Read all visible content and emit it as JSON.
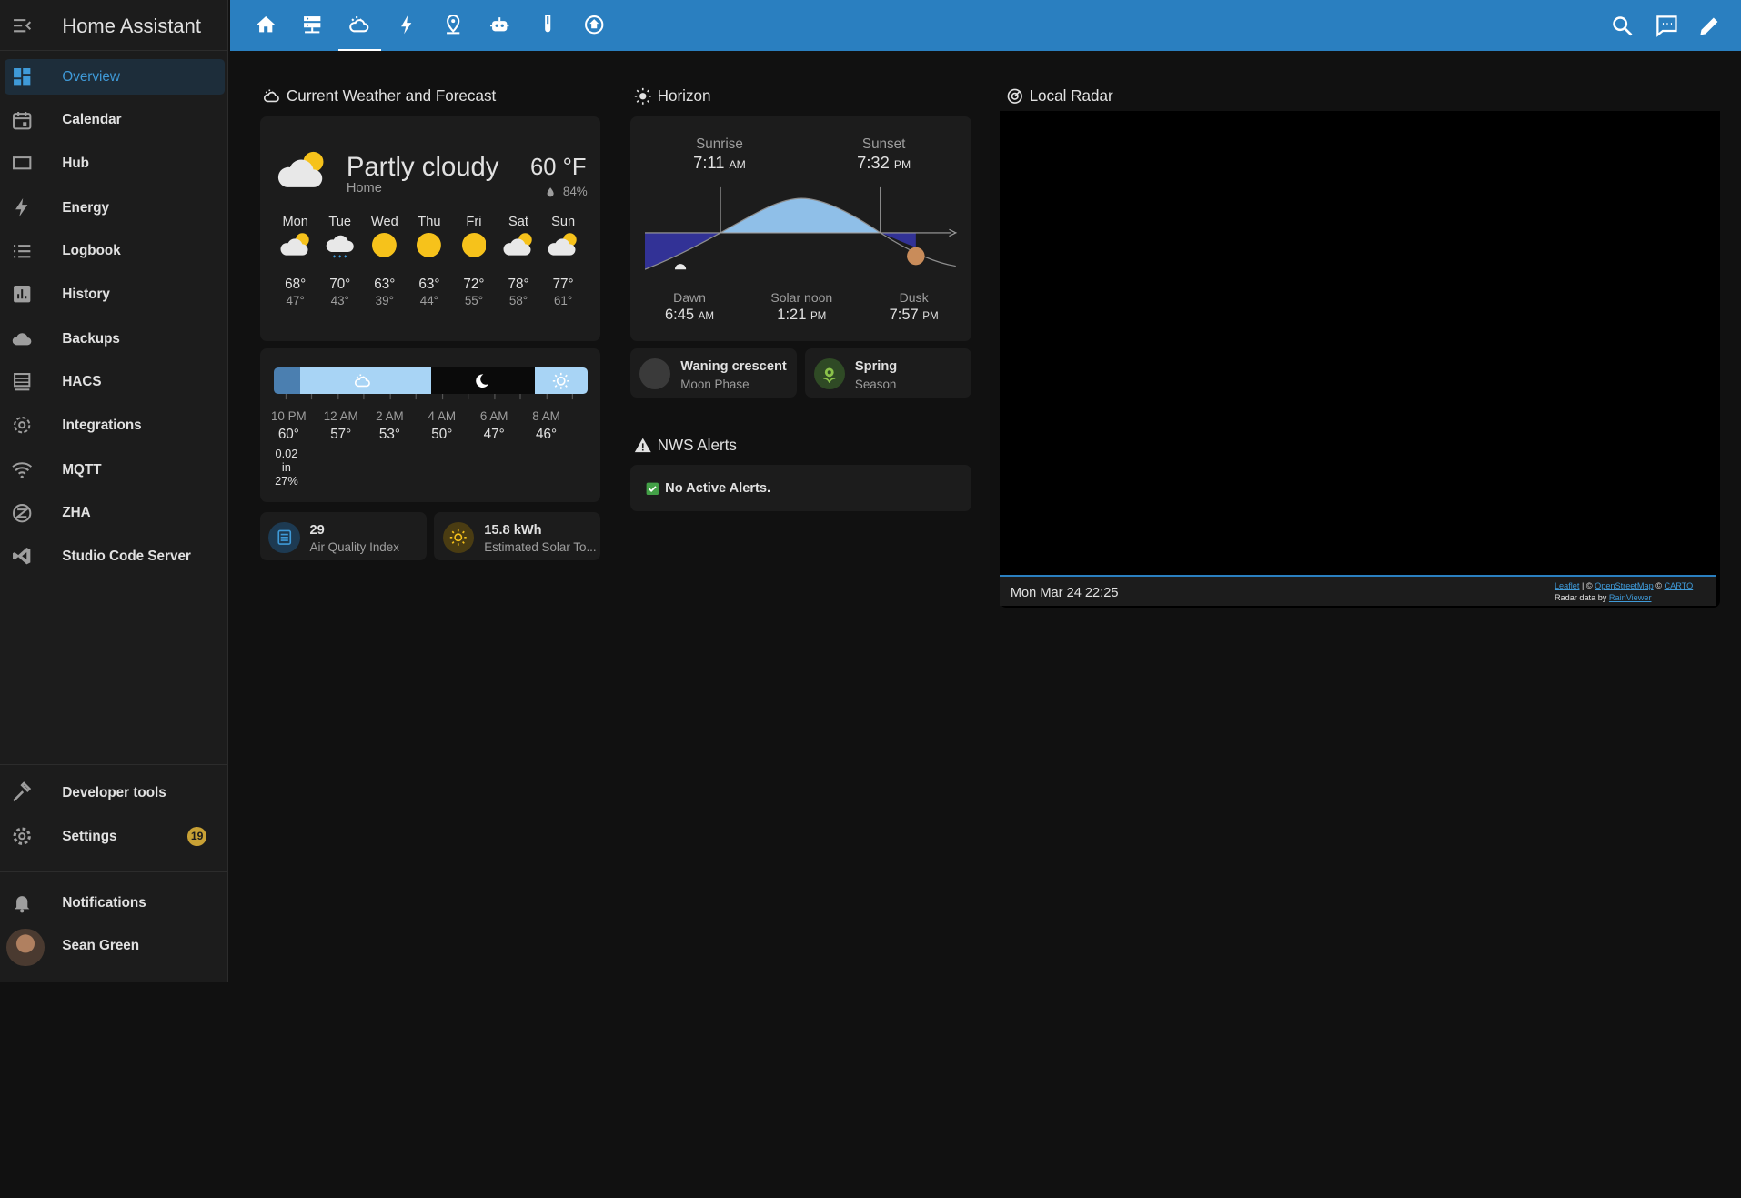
{
  "app": {
    "title": "Home Assistant"
  },
  "sidebar": {
    "items": [
      {
        "label": "Overview",
        "icon": "dashboard-icon"
      },
      {
        "label": "Calendar",
        "icon": "calendar-icon"
      },
      {
        "label": "Hub",
        "icon": "hub-icon"
      },
      {
        "label": "Energy",
        "icon": "lightning-icon"
      },
      {
        "label": "Logbook",
        "icon": "list-icon"
      },
      {
        "label": "History",
        "icon": "chart-icon"
      },
      {
        "label": "Backups",
        "icon": "cloud-icon"
      },
      {
        "label": "HACS",
        "icon": "hacs-icon"
      },
      {
        "label": "Integrations",
        "icon": "gear-icon"
      },
      {
        "label": "MQTT",
        "icon": "wifi-icon"
      },
      {
        "label": "ZHA",
        "icon": "zigbee-icon"
      },
      {
        "label": "Studio Code Server",
        "icon": "vscode-icon"
      }
    ],
    "developer_tools": "Developer tools",
    "settings": {
      "label": "Settings",
      "badge": "19"
    },
    "notifications": "Notifications",
    "user": "Sean Green"
  },
  "header": {
    "tabs": [
      "home-icon",
      "server-icon",
      "weather-icon",
      "lightning-icon",
      "map-pin-icon",
      "robot-icon",
      "test-tube-icon",
      "home-circle-icon"
    ],
    "active_tab": 2,
    "actions": [
      "search-icon",
      "assist-icon",
      "edit-icon"
    ]
  },
  "weather": {
    "section_title": "Current Weather and Forecast",
    "condition": "Partly cloudy",
    "location": "Home",
    "temperature": "60 °F",
    "humidity": "84%",
    "forecast": [
      {
        "day": "Mon",
        "icon": "partly-cloudy-icon",
        "high": "68°",
        "low": "47°"
      },
      {
        "day": "Tue",
        "icon": "rainy-cloudy-icon",
        "high": "70°",
        "low": "43°"
      },
      {
        "day": "Wed",
        "icon": "sunny-icon",
        "high": "63°",
        "low": "39°"
      },
      {
        "day": "Thu",
        "icon": "sunny-icon",
        "high": "63°",
        "low": "44°"
      },
      {
        "day": "Fri",
        "icon": "sunny-icon",
        "high": "72°",
        "low": "55°"
      },
      {
        "day": "Sat",
        "icon": "partly-cloudy-icon",
        "high": "78°",
        "low": "58°"
      },
      {
        "day": "Sun",
        "icon": "partly-cloudy-icon",
        "high": "77°",
        "low": "61°"
      }
    ],
    "hourly": [
      {
        "time": "10 PM",
        "temp": "60°",
        "precip": "0.02",
        "unit": "in",
        "chance": "27%"
      },
      {
        "time": "12 AM",
        "temp": "57°"
      },
      {
        "time": "2 AM",
        "temp": "53°"
      },
      {
        "time": "4 AM",
        "temp": "50°"
      },
      {
        "time": "6 AM",
        "temp": "47°"
      },
      {
        "time": "8 AM",
        "temp": "46°"
      }
    ],
    "air_quality": {
      "value": "29",
      "label": "Air Quality Index"
    },
    "solar": {
      "value": "15.8 kWh",
      "label": "Estimated Solar To..."
    }
  },
  "horizon": {
    "section_title": "Horizon",
    "sunrise": {
      "label": "Sunrise",
      "time": "7:11",
      "ampm": "AM"
    },
    "sunset": {
      "label": "Sunset",
      "time": "7:32",
      "ampm": "PM"
    },
    "dawn": {
      "label": "Dawn",
      "time": "6:45",
      "ampm": "AM"
    },
    "noon": {
      "label": "Solar noon",
      "time": "1:21",
      "ampm": "PM"
    },
    "dusk": {
      "label": "Dusk",
      "time": "7:57",
      "ampm": "PM"
    },
    "moon": {
      "value": "Waning crescent",
      "label": "Moon Phase"
    },
    "season": {
      "value": "Spring",
      "label": "Season"
    }
  },
  "alerts": {
    "section_title": "NWS Alerts",
    "status": "No Active Alerts."
  },
  "radar": {
    "section_title": "Local Radar",
    "timestamp": "Mon Mar 24 22:25",
    "attr_leaflet": "Leaflet",
    "attr_sep1": "| ©",
    "attr_osm": "OpenStreetMap",
    "attr_sep2": "©",
    "attr_carto": "CARTO",
    "attr_radar": "Radar data by",
    "attr_rainviewer": "RainViewer"
  },
  "colors": {
    "header": "#2a7fc0",
    "accent": "#3f9ad8",
    "badge": "#c8a135"
  }
}
